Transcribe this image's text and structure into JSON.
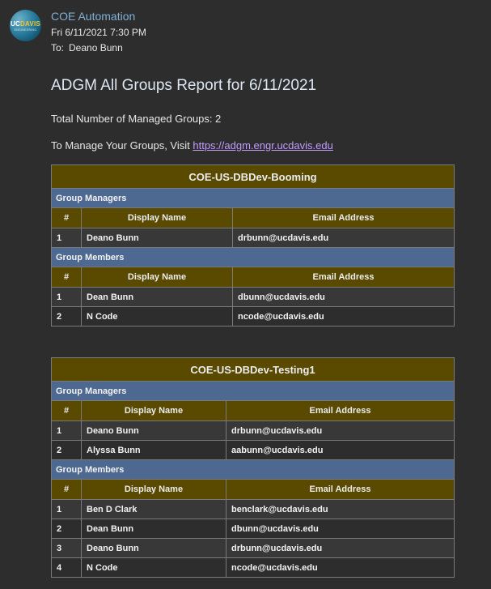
{
  "email": {
    "sender": "COE Automation",
    "date": "Fri 6/11/2021 7:30 PM",
    "to_label": "To:",
    "to": "Deano Bunn",
    "avatar": {
      "line1_uc": "UC",
      "line1_davis": "DAVIS",
      "line2": "ENGINEERING"
    }
  },
  "report": {
    "title": "ADGM All Groups Report for 6/11/2021",
    "total": "Total Number of Managed Groups: 2",
    "manage_prefix": "To Manage Your Groups, Visit ",
    "manage_link": "https://adgm.engr.ucdavis.edu"
  },
  "labels": {
    "group_managers": "Group Managers",
    "group_members": "Group Members",
    "col_num": "#",
    "col_name": "Display Name",
    "col_email": "Email Address"
  },
  "groups": [
    {
      "name": "COE-US-DBDev-Booming",
      "managers": [
        {
          "num": "1",
          "name": "Deano Bunn",
          "email": "drbunn@ucdavis.edu"
        }
      ],
      "members": [
        {
          "num": "1",
          "name": "Dean Bunn",
          "email": "dbunn@ucdavis.edu"
        },
        {
          "num": "2",
          "name": "N Code",
          "email": "ncode@ucdavis.edu"
        }
      ]
    },
    {
      "name": "COE-US-DBDev-Testing1",
      "managers": [
        {
          "num": "1",
          "name": "Deano Bunn",
          "email": "drbunn@ucdavis.edu"
        },
        {
          "num": "2",
          "name": "Alyssa Bunn",
          "email": "aabunn@ucdavis.edu"
        }
      ],
      "members": [
        {
          "num": "1",
          "name": "Ben D Clark",
          "email": "benclark@ucdavis.edu"
        },
        {
          "num": "2",
          "name": "Dean Bunn",
          "email": "dbunn@ucdavis.edu"
        },
        {
          "num": "3",
          "name": "Deano Bunn",
          "email": "drbunn@ucdavis.edu"
        },
        {
          "num": "4",
          "name": "N Code",
          "email": "ncode@ucdavis.edu"
        }
      ]
    }
  ]
}
